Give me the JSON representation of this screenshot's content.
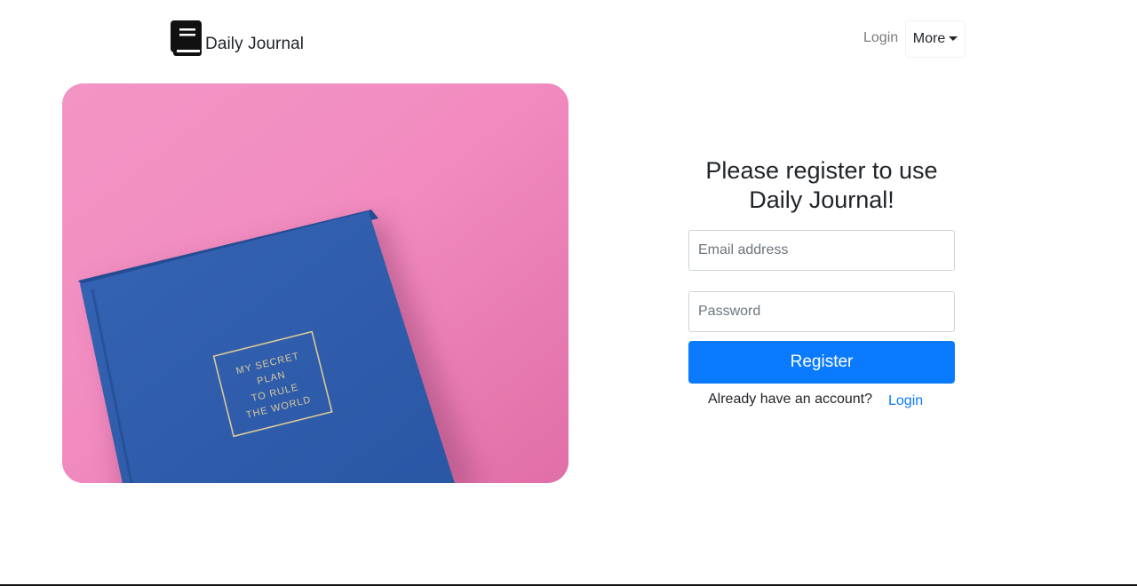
{
  "navbar": {
    "brand_name": "Daily Journal",
    "login_link": "Login",
    "more_button": "More"
  },
  "hero": {
    "book_cover_lines": [
      "MY SECRET",
      "PLAN",
      "TO RULE",
      "THE WORLD"
    ]
  },
  "register_form": {
    "title_line1": "Please register to use",
    "title_line2": "Daily Journal!",
    "email_placeholder": "Email address",
    "password_placeholder": "Password",
    "register_button": "Register",
    "already_text": "Already have an account?",
    "login_link": "Login"
  },
  "colors": {
    "primary": "#0a7bff",
    "hero_background": "#f08bbd",
    "book_blue": "#2f5fae"
  },
  "icons": {
    "brand": "book-icon",
    "dropdown": "caret-down-icon"
  }
}
